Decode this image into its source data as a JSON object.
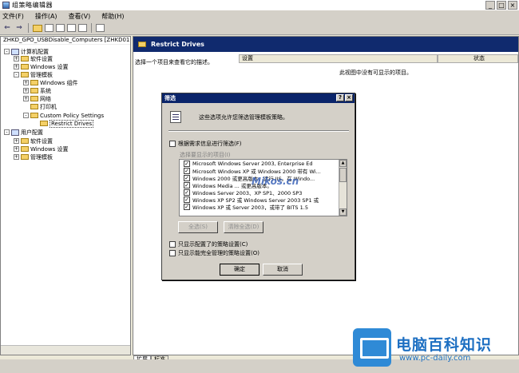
{
  "window": {
    "title": "组策略编辑器",
    "min": "_",
    "max": "□",
    "close": "×"
  },
  "menu": [
    "文件(F)",
    "操作(A)",
    "查看(V)",
    "帮助(H)"
  ],
  "toolbar": {
    "back": "⇐",
    "forward": "⇒"
  },
  "tree": {
    "root": "ZHKD_GPO_USBDisable_Computers [ZHKD01...",
    "items": [
      {
        "label": "计算机配置",
        "exp": "-",
        "icon": "computer-icon"
      },
      {
        "label": "软件设置",
        "exp": "+",
        "icon": "folder-icon"
      },
      {
        "label": "Windows 设置",
        "exp": "+",
        "icon": "folder-icon"
      },
      {
        "label": "管理模板",
        "exp": "-",
        "icon": "folder-icon"
      },
      {
        "label": "Windows 组件",
        "exp": "+",
        "icon": "folder-icon"
      },
      {
        "label": "系统",
        "exp": "+",
        "icon": "folder-icon"
      },
      {
        "label": "网络",
        "exp": "+",
        "icon": "folder-icon"
      },
      {
        "label": "打印机",
        "exp": "",
        "icon": "folder-icon"
      },
      {
        "label": "Custom Policy Settings",
        "exp": "-",
        "icon": "folder-icon"
      },
      {
        "label": "Restrict Drives",
        "exp": "",
        "icon": "folder-icon"
      },
      {
        "label": "用户配置",
        "exp": "-",
        "icon": "user-icon"
      },
      {
        "label": "软件设置",
        "exp": "+",
        "icon": "folder-icon"
      },
      {
        "label": "Windows 设置",
        "exp": "+",
        "icon": "folder-icon"
      },
      {
        "label": "管理模板",
        "exp": "+",
        "icon": "folder-icon"
      }
    ]
  },
  "right": {
    "header": "Restrict Drives",
    "description": "选择一个项目来查看它的描述。",
    "columns": [
      "设置",
      "状态"
    ],
    "empty": "此视图中没有可显示的项目。",
    "tabs": [
      "扩展",
      "标准"
    ]
  },
  "dialog": {
    "title": "筛选",
    "help": "?",
    "close": "×",
    "intro": "这些选项允许您筛选管理模板策略。",
    "filter_requirements": "根据需求信息进行筛选(F)",
    "list_label": "选择要显示的项目(I)",
    "list_items": [
      "Microsoft Windows Server 2003, Enterprise Ed",
      "Microsoft Windows XP 或 Windows 2000 带有 Wi...",
      "Windows 2000 或更高版本，运行 IIS。在 Windo...",
      "Windows Media ... 或更高版本。",
      "Windows Server 2003、XP SP1、2000 SP3",
      "Windows XP SP2 或 Windows Server 2003 SP1 或",
      "Windows XP 或 Server 2003，或带了 BITS 1.5"
    ],
    "watermark": "Mikos.cn",
    "select_all": "全选(S)",
    "deselect_all": "清除全选(D)",
    "only_configured": "只显示配置了的策略设置(C)",
    "only_managed": "只显示能完全管理的策略设置(O)",
    "ok": "确定",
    "cancel": "取消"
  },
  "brand": {
    "title": "电脑百科知识",
    "url": "www.pc-daily.com"
  }
}
